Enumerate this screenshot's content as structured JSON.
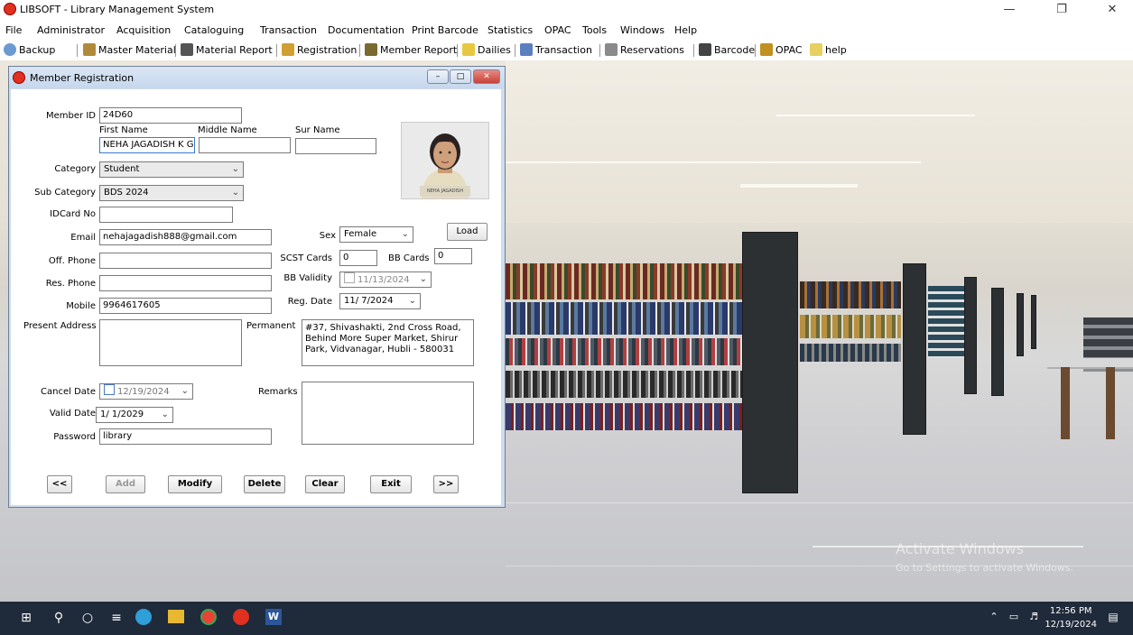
{
  "app": {
    "title": "LIBSOFT - Library Management System"
  },
  "menu": [
    "File",
    "Administrator",
    "Acquisition",
    "Cataloguing",
    "Transaction",
    "Documentation",
    "Print Barcode",
    "Statistics",
    "OPAC",
    "Tools",
    "Windows",
    "Help"
  ],
  "toolbar": [
    "Backup",
    "Master Material",
    "Material Report",
    "Registration",
    "Member Report",
    "Dailies",
    "Transaction",
    "Reservations",
    "Barcode",
    "OPAC",
    "help"
  ],
  "window": {
    "title": "Member Registration"
  },
  "form": {
    "member_id_label": "Member ID",
    "member_id": "24D60",
    "first_name_label": "First Name",
    "middle_name_label": "Middle Name",
    "sur_name_label": "Sur Name",
    "first_name": "NEHA JAGADISH K G",
    "middle_name": "",
    "sur_name": "",
    "category_label": "Category",
    "category": "Student",
    "sub_category_label": "Sub Category",
    "sub_category": "BDS 2024",
    "idcard_label": "IDCard No",
    "idcard": "",
    "email_label": "Email",
    "email": "nehajagadish888@gmail.com",
    "sex_label": "Sex",
    "sex": "Female",
    "load_button": "Load",
    "off_phone_label": "Off. Phone",
    "off_phone": "",
    "scst_label": "SCST Cards",
    "scst": "0",
    "bb_cards_label": "BB Cards",
    "bb_cards": "0",
    "res_phone_label": "Res. Phone",
    "res_phone": "",
    "bb_validity_label": "BB Validity",
    "bb_validity": "11/13/2024",
    "mobile_label": "Mobile",
    "mobile": "9964617605",
    "reg_date_label": "Reg. Date",
    "reg_date": "11/ 7/2024",
    "present_address_label": "Present Address",
    "present_address": "",
    "permanent_label": "Permanent",
    "permanent_address": "#37, Shivashakti, 2nd Cross Road, Behind More Super Market, Shirur Park, Vidvanagar, Hubli - 580031",
    "cancel_date_label": "Cancel Date",
    "cancel_date": "12/19/2024",
    "remarks_label": "Remarks",
    "remarks": "",
    "valid_date_label": "Valid Date",
    "valid_date": "1/ 1/2029",
    "password_label": "Password",
    "password": "library",
    "photo_caption": "NEHA JAGADISH"
  },
  "buttons": {
    "prev": "<<",
    "add": "Add",
    "modify": "Modify",
    "delete": "Delete",
    "clear": "Clear",
    "exit": "Exit",
    "next": ">>"
  },
  "watermark": {
    "line1": "Activate Windows",
    "line2": "Go to Settings to activate Windows."
  },
  "taskbar": {
    "time": "12:56 PM",
    "date": "12/19/2024"
  },
  "colors": {
    "window_frame": "#cfdcec",
    "taskbar": "#1f2a3a",
    "accent_close": "#c84238"
  }
}
